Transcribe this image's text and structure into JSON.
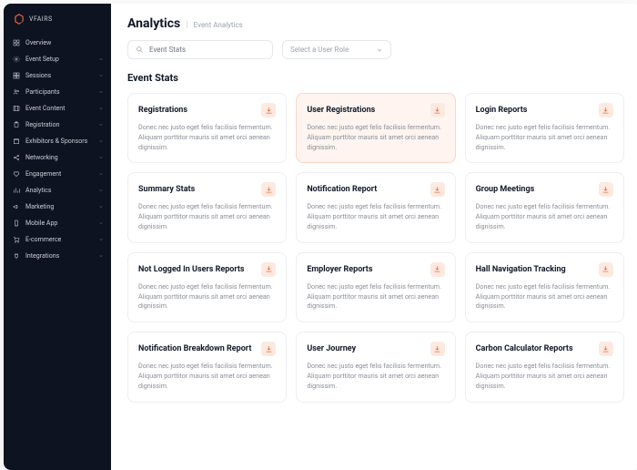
{
  "brand": {
    "name": "vFAIRS"
  },
  "sidebar": {
    "items": [
      {
        "label": "Overview",
        "icon": "grid",
        "chev": false
      },
      {
        "label": "Event Setup",
        "icon": "gear",
        "chev": true
      },
      {
        "label": "Sessions",
        "icon": "tiles",
        "chev": true
      },
      {
        "label": "Participants",
        "icon": "users",
        "chev": true
      },
      {
        "label": "Event Content",
        "icon": "film",
        "chev": true
      },
      {
        "label": "Registration",
        "icon": "clipboard",
        "chev": true
      },
      {
        "label": "Exhibitors & Sponsors",
        "icon": "booth",
        "chev": true
      },
      {
        "label": "Networking",
        "icon": "share",
        "chev": true
      },
      {
        "label": "Engagement",
        "icon": "heart",
        "chev": true
      },
      {
        "label": "Analytics",
        "icon": "chart",
        "chev": true
      },
      {
        "label": "Marketing",
        "icon": "megaphone",
        "chev": true
      },
      {
        "label": "Mobile App",
        "icon": "phone",
        "chev": true
      },
      {
        "label": "E-commerce",
        "icon": "cart",
        "chev": true
      },
      {
        "label": "Integrations",
        "icon": "plug",
        "chev": true
      }
    ]
  },
  "header": {
    "title": "Analytics",
    "subtitle": "Event Analytics"
  },
  "controls": {
    "search_placeholder": "Event Stats",
    "select_placeholder": "Select a User Role"
  },
  "section_title": "Event Stats",
  "card_desc": "Donec nec justo eget felis facilisis fermentum. Aliquam porttitor mauris sit amet orci aenean dignissim.",
  "cards": [
    {
      "title": "Registrations",
      "highlight": false
    },
    {
      "title": "User Registrations",
      "highlight": true
    },
    {
      "title": "Login Reports",
      "highlight": false
    },
    {
      "title": "Summary Stats",
      "highlight": false
    },
    {
      "title": "Notification Report",
      "highlight": false
    },
    {
      "title": "Group Meetings",
      "highlight": false
    },
    {
      "title": "Not Logged In Users Reports",
      "highlight": false
    },
    {
      "title": "Employer Reports",
      "highlight": false
    },
    {
      "title": "Hall Navigation Tracking",
      "highlight": false
    },
    {
      "title": "Notification Breakdown Report",
      "highlight": false
    },
    {
      "title": "User Journey",
      "highlight": false
    },
    {
      "title": "Carbon Calculator Reports",
      "highlight": false
    }
  ],
  "colors": {
    "accent": "#ed6a3a"
  }
}
